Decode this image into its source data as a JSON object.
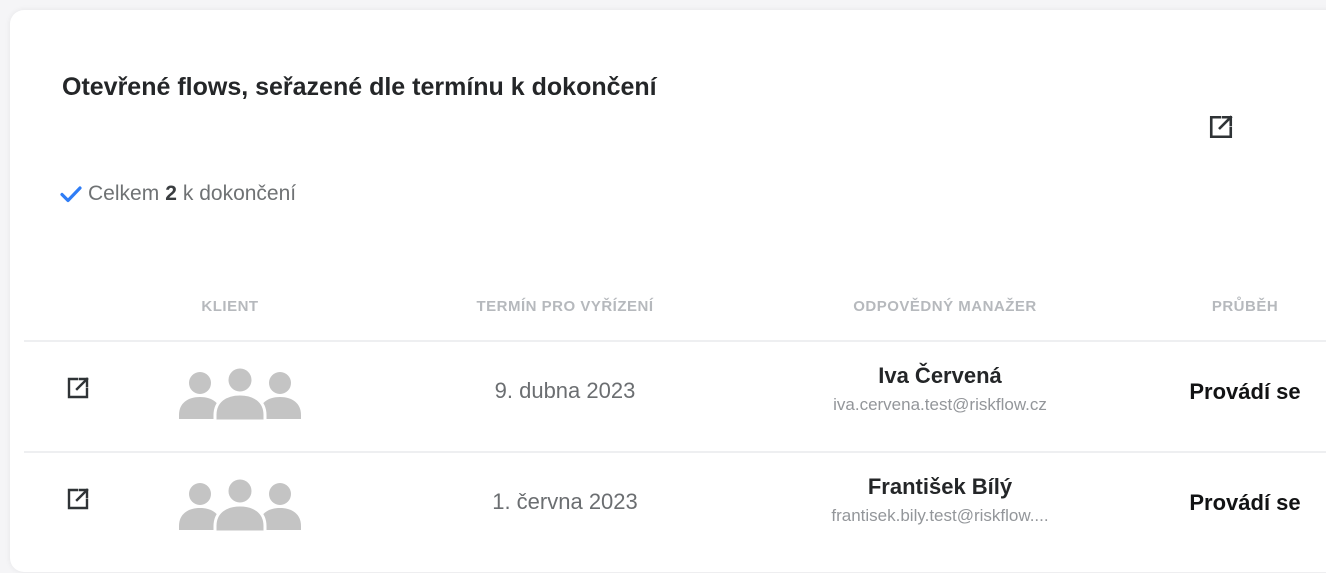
{
  "panel": {
    "title": "Otevřené flows, seřazené dle termínu k dokončení",
    "open_icon": "external-link-icon",
    "summary": {
      "icon": "checkmark-icon",
      "prefix": "Celkem",
      "count": "2",
      "suffix": "k dokončení"
    }
  },
  "table": {
    "columns": [
      "KLIENT",
      "TERMÍN PRO VYŘÍZENÍ",
      "ODPOVĚDNÝ MANAŽER",
      "PRŮBĚH"
    ],
    "rows": [
      {
        "client_icon": "group-avatar-icon",
        "deadline": "9. dubna 2023",
        "manager_name": "Iva Červená",
        "manager_email": "iva.cervena.test@riskflow.cz",
        "progress": "Provádí se"
      },
      {
        "client_icon": "group-avatar-icon",
        "deadline": "1. června 2023",
        "manager_name": "František Bílý",
        "manager_email": "frantisek.bily.test@riskflow....",
        "progress": "Provádí se"
      }
    ]
  },
  "colors": {
    "accent": "#2f7df6",
    "header_text": "#b6b9bd",
    "avatar": "#c4c4c4"
  }
}
